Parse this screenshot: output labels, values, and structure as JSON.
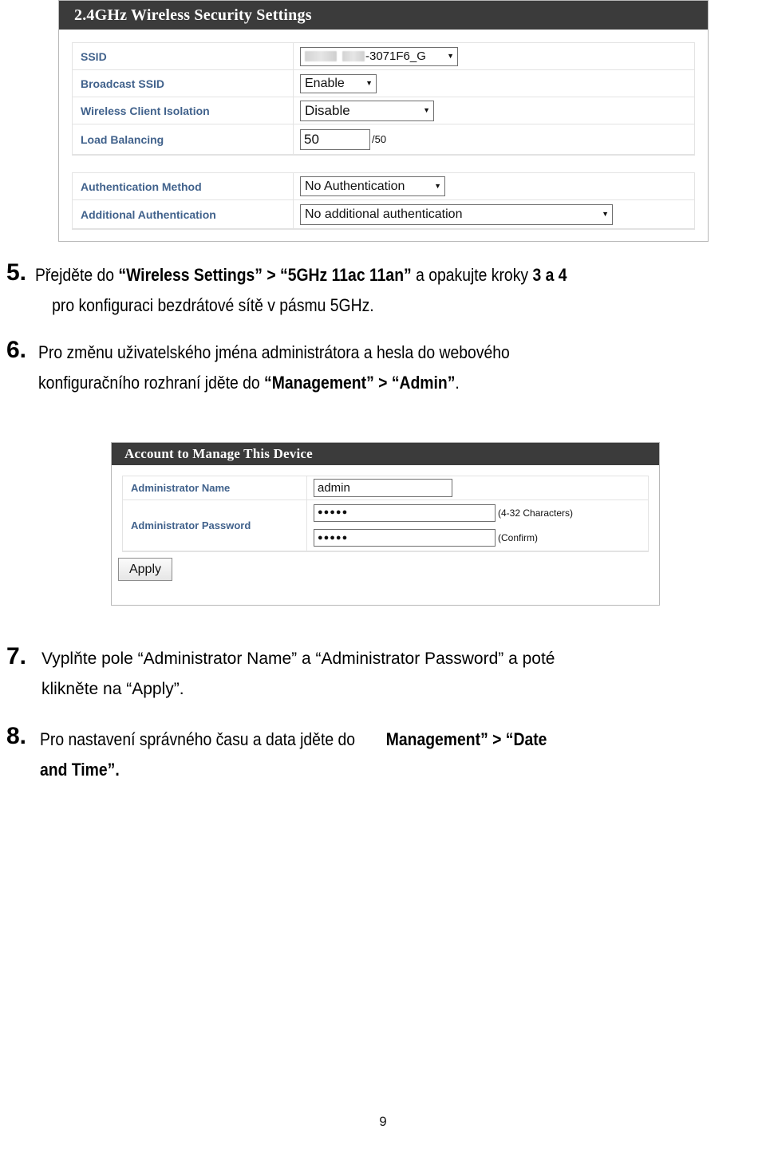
{
  "page": {
    "number": "9",
    "background": "#ffffff"
  },
  "colors": {
    "panel_header_bg": "#3b3b3b",
    "panel_header_text": "#ffffff",
    "field_label": "#41628c",
    "border": "#b8b8b8",
    "row_border": "#e3e3e3"
  },
  "wireless_panel": {
    "title": "2.4GHz Wireless Security Settings",
    "rows": [
      {
        "label": "SSID",
        "control": "select",
        "value": "-3071F6_G",
        "redacted": true,
        "caret": "▼"
      },
      {
        "label": "Broadcast SSID",
        "control": "select",
        "value": "Enable",
        "caret": "▼"
      },
      {
        "label": "Wireless Client Isolation",
        "control": "select",
        "value": "Disable",
        "caret": "▼"
      },
      {
        "label": "Load Balancing",
        "control": "text",
        "value": "50",
        "suffix": "/50"
      }
    ],
    "auth_rows": [
      {
        "label": "Authentication Method",
        "control": "select",
        "value": "No Authentication",
        "caret": "▼"
      },
      {
        "label": "Additional Authentication",
        "control": "select",
        "value": "No additional authentication",
        "caret": "▼"
      }
    ]
  },
  "account_panel": {
    "title": "Account to Manage This Device",
    "rows": [
      {
        "label": "Administrator Name",
        "value": "admin"
      },
      {
        "label": "Administrator Password",
        "password_value": "●●●●●",
        "hint_1": "(4-32 Characters)",
        "confirm_value": "●●●●●",
        "hint_2": "(Confirm)"
      }
    ],
    "apply_label": "Apply"
  },
  "steps": [
    {
      "number": "5.",
      "line1_a": "Přejděte do ",
      "line1_b": "“Wireless Settings” > “5GHz 11ac 11an”",
      "line1_c": " a opakujte kroky ",
      "line1_d": "3 a 4",
      "line2": "pro konfiguraci bezdrátové sítě v pásmu 5GHz."
    },
    {
      "number": "6.",
      "line1": "Pro změnu uživatelského jména administrátora a hesla do webového",
      "line2_a": "konfiguračního rozhraní jděte do ",
      "line2_b": "“Management” > “Admin”",
      "line2_c": "."
    },
    {
      "number": "7.",
      "line1": "Vyplňte pole “Administrator Name” a “Administrator Password” a poté",
      "line2": "klikněte na “Apply”."
    },
    {
      "number": "8.",
      "line1_a": "Pro nastavení správného času a data jděte do",
      "line1_b": "Management” > “Date",
      "line2": "and Time”."
    }
  ]
}
